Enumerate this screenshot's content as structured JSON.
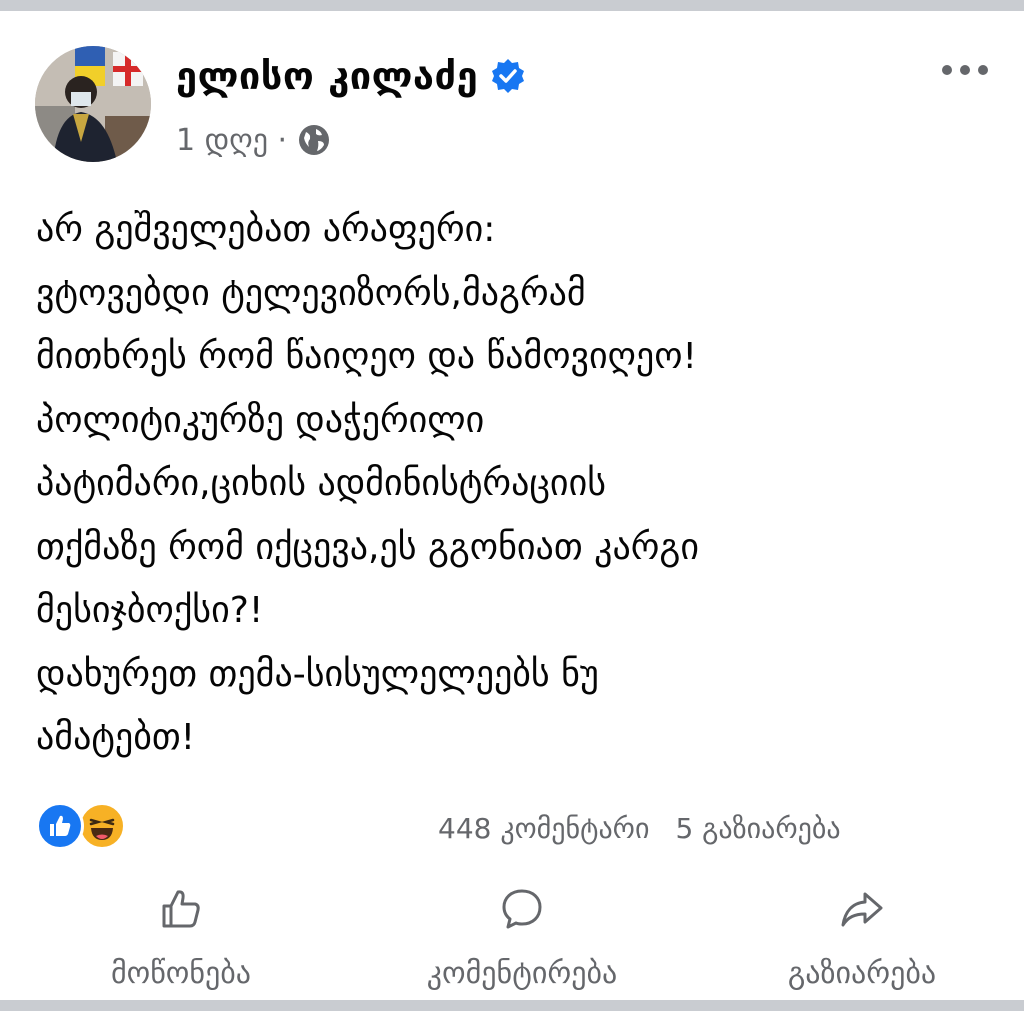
{
  "post": {
    "author": "ელისო კილაძე",
    "time": "1 დღე ·",
    "text_lines": [
      "არ გეშველებათ არაფერი:",
      "ვტოვებდი ტელევიზორს,მაგრამ",
      "მითხრეს რომ წაიღეო და წამოვიღეო!",
      "პოლიტიკურზე დაჭერილი",
      "პატიმარი,ციხის ადმინისტრაციის",
      "თქმაზე რომ იქცევა,ეს გგონიათ კარგი",
      "მესიჯბოქსი?!",
      "დახურეთ თემა-სისულელეებს ნუ",
      "ამატებთ!"
    ],
    "text": "არ გეშველებათ არაფერი:\nვტოვებდი ტელევიზორს,მაგრამ\nმითხრეს რომ წაიღეო და წამოვიღეო!\nპოლიტიკურზე დაჭერილი\nპატიმარი,ციხის ადმინისტრაციის\nთქმაზე რომ იქცევა,ეს გგონიათ კარგი\nმესიჯბოქსი?!\nდახურეთ თემა-სისულელეებს ნუ\nამატებთ!"
  },
  "reactions": [
    "like-icon",
    "haha-emoji-icon"
  ],
  "stats": {
    "comments": "448 კომენტარი",
    "shares": "5 გაზიარება"
  },
  "actions": {
    "like": "მოწონება",
    "comment": "კომენტირება",
    "share": "გაზიარება"
  },
  "colors": {
    "accent": "#1877f2",
    "secondary_text": "#65676b",
    "separator": "#c9ccd1"
  }
}
